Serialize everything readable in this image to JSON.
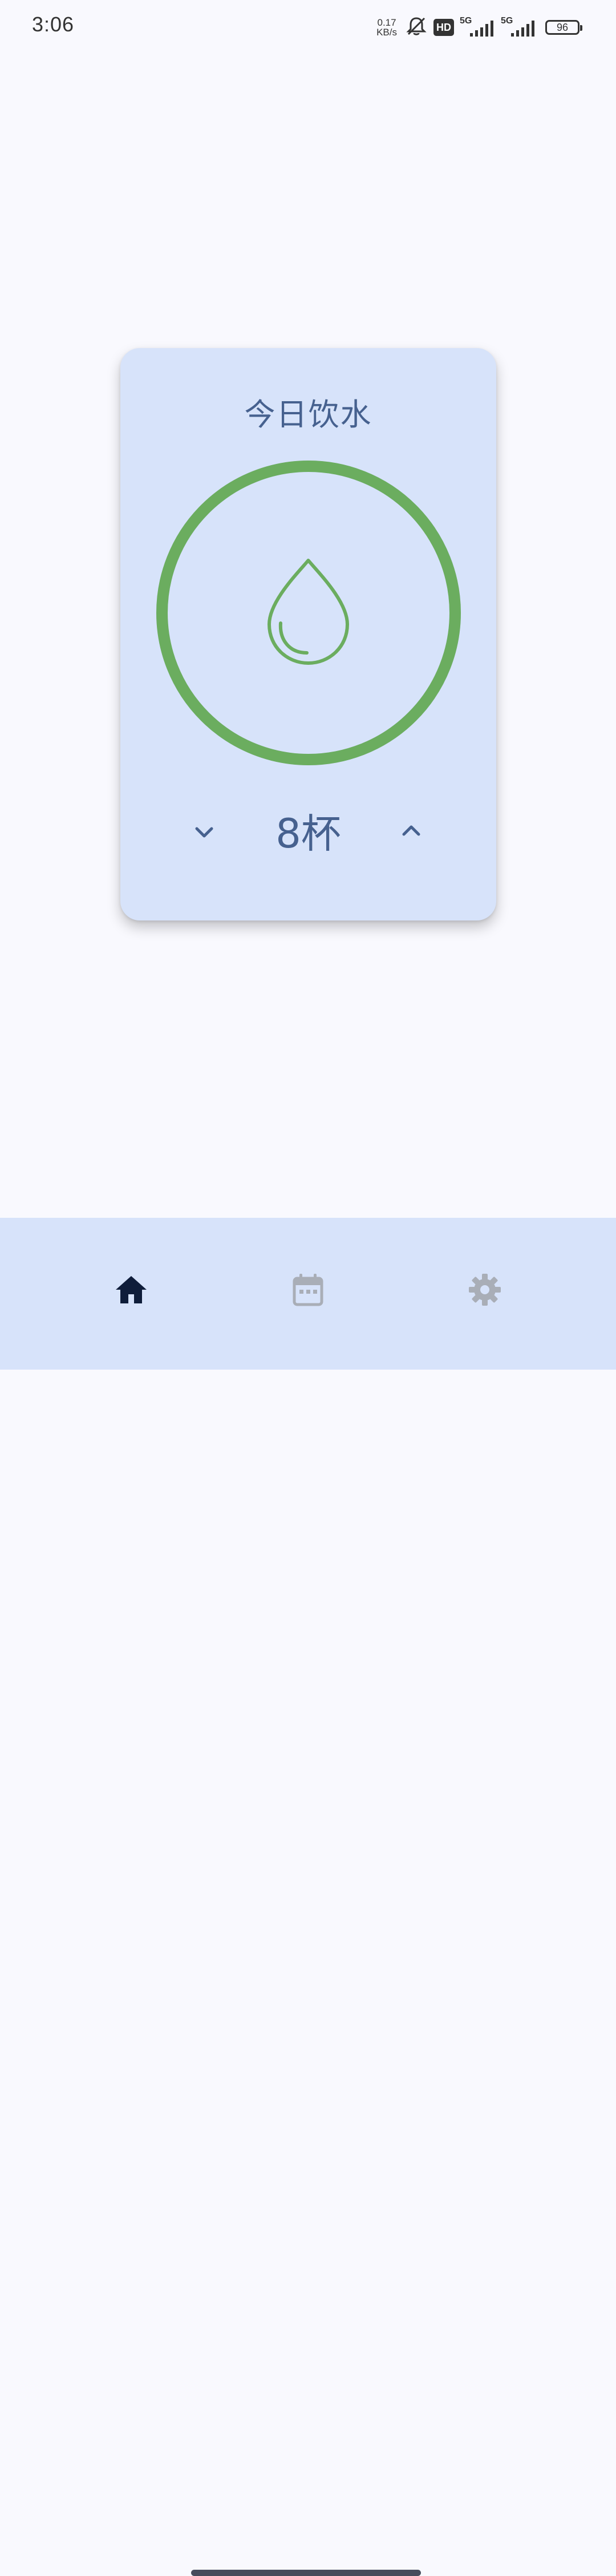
{
  "status_bar": {
    "time": "3:06",
    "net_speed_value": "0.17",
    "net_speed_unit": "KB/s",
    "hd_badge": "HD",
    "network_1": "5G",
    "network_2": "5G",
    "battery": "96"
  },
  "card": {
    "title": "今日饮水",
    "cup_count": "8杯",
    "progress": 1.0,
    "ring_color": "#6bad5f",
    "background": "#d7e3fa",
    "text_color": "#46618f"
  },
  "bottom_nav": {
    "items": [
      {
        "icon": "home-icon",
        "active": true
      },
      {
        "icon": "calendar-icon",
        "active": false
      },
      {
        "icon": "gear-icon",
        "active": false
      }
    ],
    "active_color": "#0f1d3a",
    "inactive_color": "#a9aeb7"
  }
}
